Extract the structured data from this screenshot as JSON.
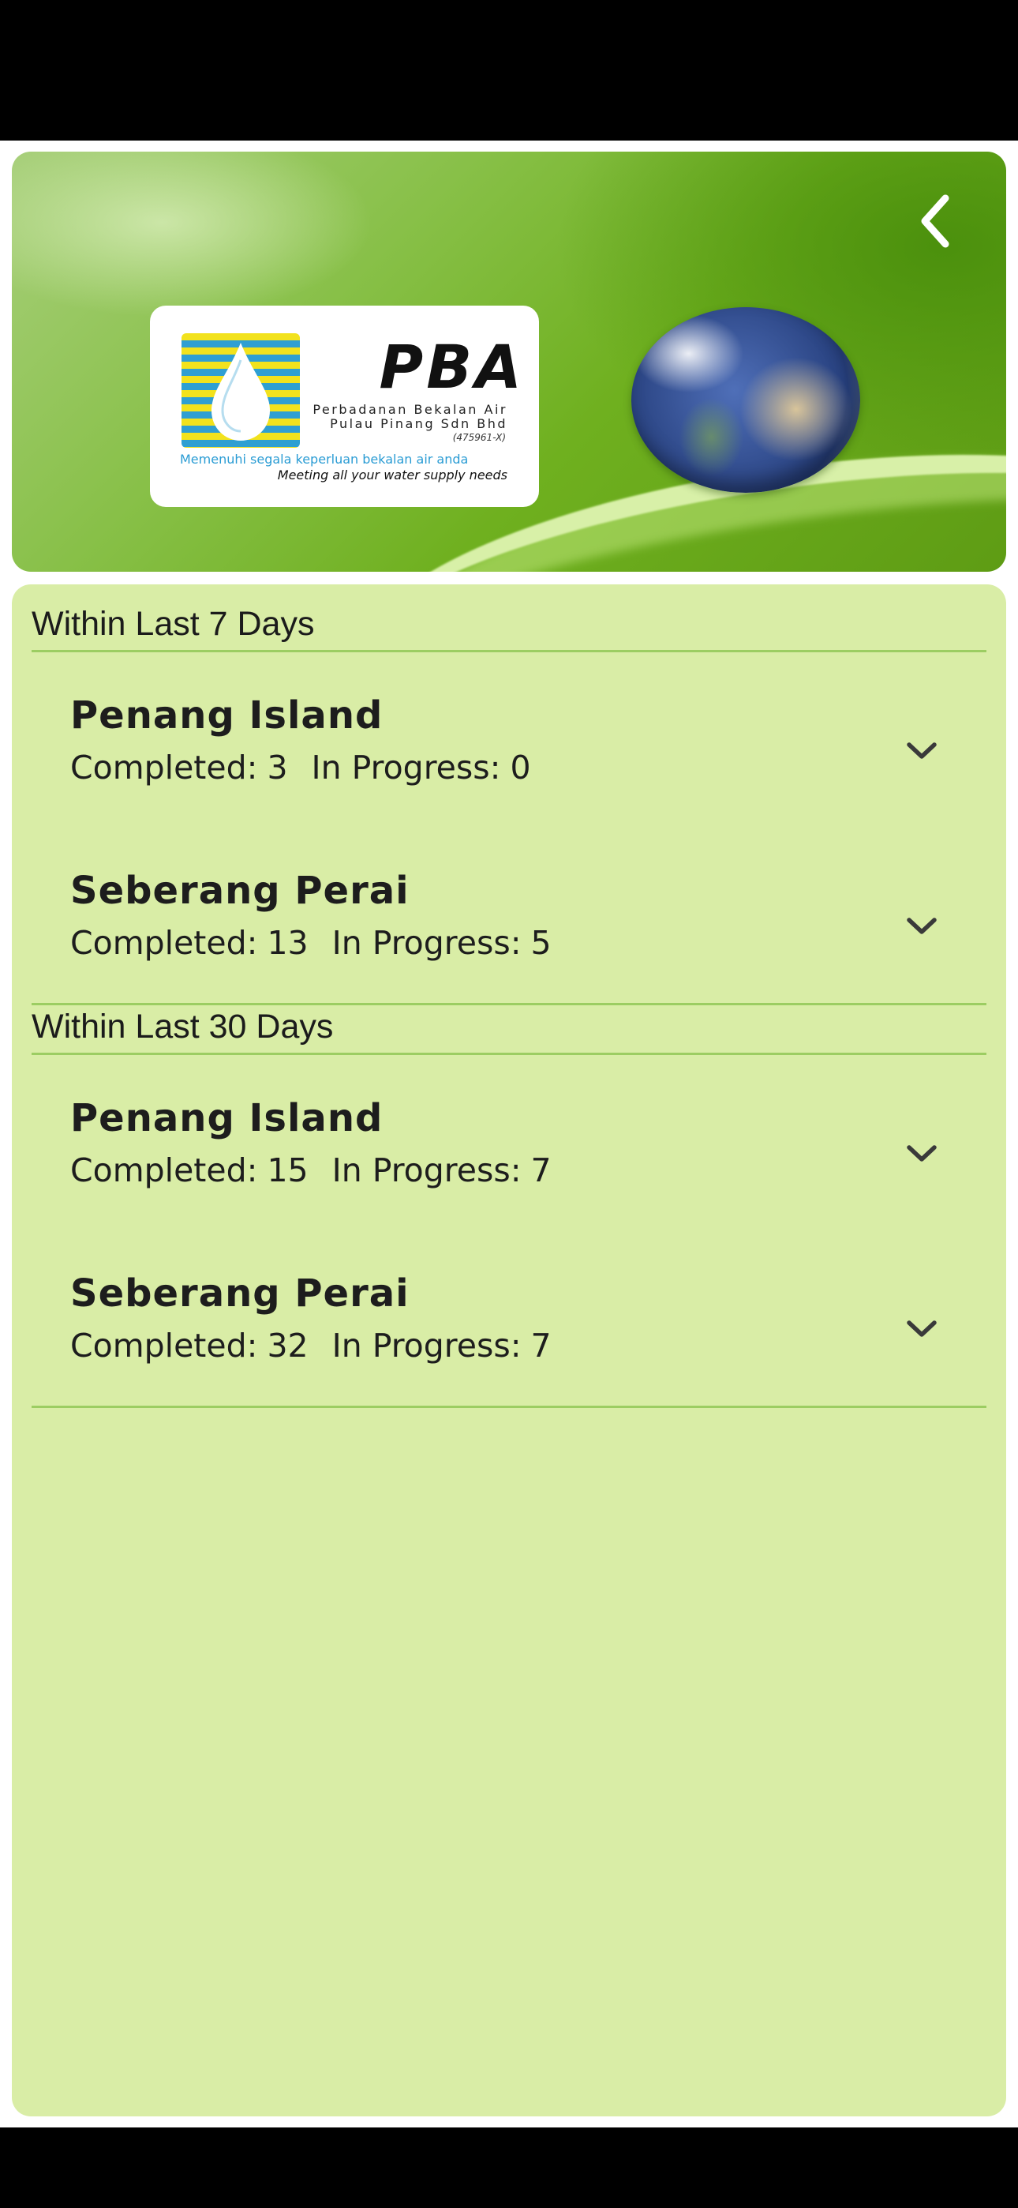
{
  "banner": {
    "logo": {
      "title": "PBA",
      "company_line1": "Perbadanan Bekalan Air",
      "company_line2": "Pulau Pinang Sdn Bhd",
      "registration": "(475961-X)",
      "tagline_ms": "Memenuhi segala keperluan bekalan air anda",
      "tagline_en": "Meeting all your water supply needs"
    },
    "back_icon": "chevron-left-icon"
  },
  "sections": [
    {
      "title": "Within Last 7 Days",
      "regions": [
        {
          "name": "Penang Island",
          "completed_label": "Completed:",
          "completed": "3",
          "in_progress_label": "In Progress:",
          "in_progress": "0"
        },
        {
          "name": "Seberang Perai",
          "completed_label": "Completed:",
          "completed": "13",
          "in_progress_label": "In Progress:",
          "in_progress": "5"
        }
      ]
    },
    {
      "title": "Within Last 30 Days",
      "regions": [
        {
          "name": "Penang Island",
          "completed_label": "Completed:",
          "completed": "15",
          "in_progress_label": "In Progress:",
          "in_progress": "7"
        },
        {
          "name": "Seberang Perai",
          "completed_label": "Completed:",
          "completed": "32",
          "in_progress_label": "In Progress:",
          "in_progress": "7"
        }
      ]
    }
  ],
  "colors": {
    "panel_background": "#d9eda6",
    "divider": "#9ccd62",
    "text": "#1d1d1d"
  }
}
